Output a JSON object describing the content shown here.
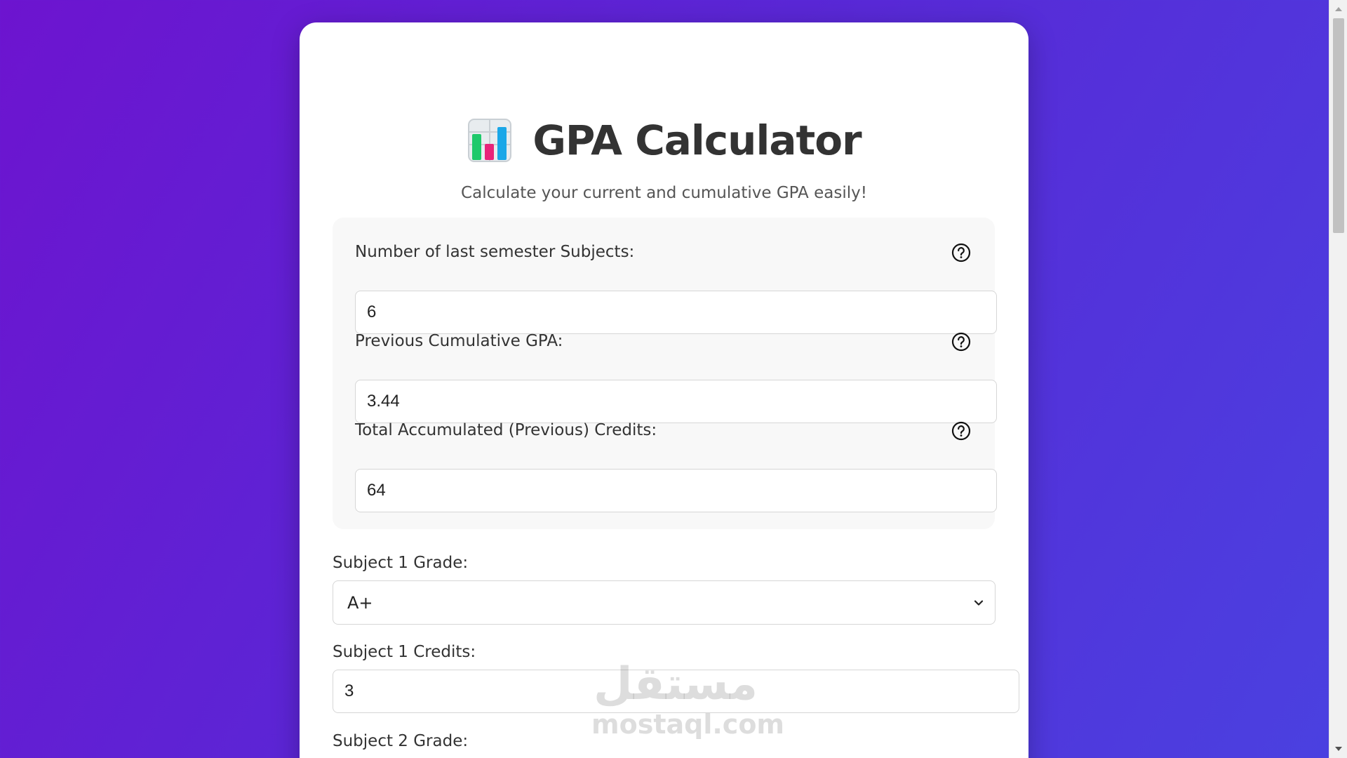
{
  "header": {
    "icon": "bar-chart-icon",
    "title": "GPA Calculator",
    "subtitle": "Calculate your current and cumulative GPA easily!"
  },
  "panel": {
    "fields": [
      {
        "label": "Number of last semester Subjects:",
        "value": "6",
        "help_icon": "question-circle-icon"
      },
      {
        "label": "Previous Cumulative GPA:",
        "value": "3.44",
        "help_icon": "question-circle-icon"
      },
      {
        "label": "Total Accumulated (Previous) Credits:",
        "value": "64",
        "help_icon": "question-circle-icon"
      }
    ]
  },
  "subjects": [
    {
      "grade_label": "Subject 1 Grade:",
      "grade_value": "A+",
      "credits_label": "Subject 1 Credits:",
      "credits_value": "3"
    },
    {
      "grade_label": "Subject 2 Grade:"
    }
  ],
  "watermark": {
    "arabic": "مستقل",
    "latin": "mostaql.com"
  },
  "colors": {
    "background_start": "#6d14cf",
    "background_end": "#4a41e0",
    "card": "#ffffff",
    "panel": "#f8f8f8"
  }
}
